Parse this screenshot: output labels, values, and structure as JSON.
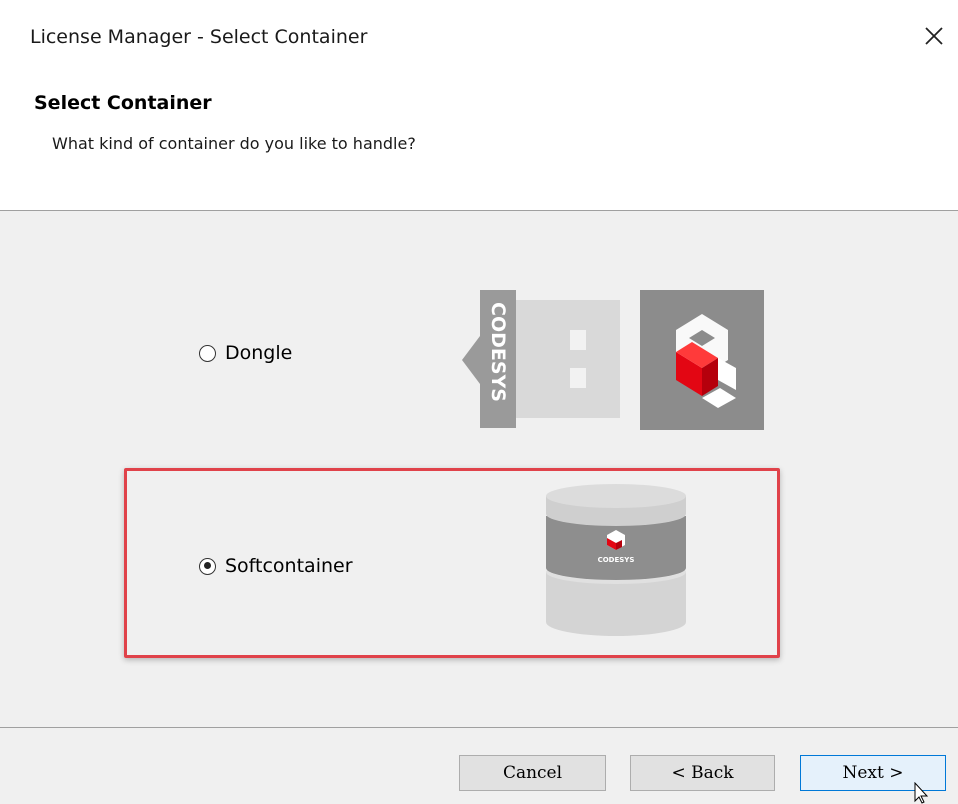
{
  "window": {
    "title": "License Manager - Select Container",
    "close_label": "×"
  },
  "header": {
    "title": "Select Container",
    "subtitle": "What kind of container do you like to handle?"
  },
  "options": [
    {
      "label": "Dongle",
      "selected": false,
      "icon": "codesys-dongle-icon",
      "brand_text": "CODESYS"
    },
    {
      "label": "Softcontainer",
      "selected": true,
      "icon": "codesys-softcontainer-icon",
      "brand_text": "CODESYS"
    }
  ],
  "buttons": {
    "cancel": "Cancel",
    "back": "< Back",
    "next": "Next >"
  },
  "colors": {
    "highlight": "#e0424a",
    "codesys_red": "#e30613",
    "dongle_gray": "#9a9a9a",
    "default_button_border": "#0078d7"
  }
}
